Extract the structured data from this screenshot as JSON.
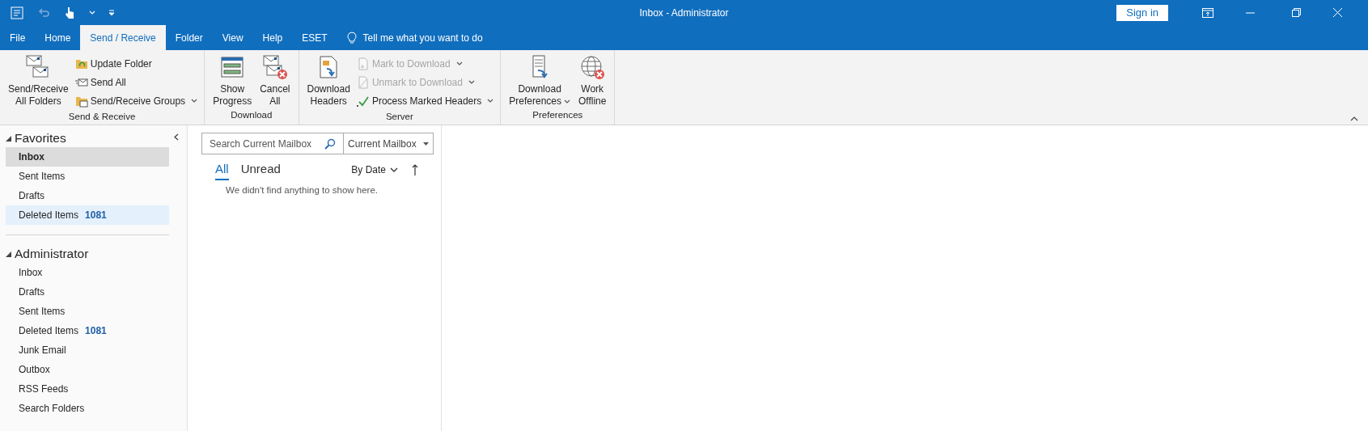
{
  "window": {
    "title": "Inbox - Administrator",
    "sign_in": "Sign in"
  },
  "tabs": [
    {
      "label": "File",
      "selected": false
    },
    {
      "label": "Home",
      "selected": false
    },
    {
      "label": "Send / Receive",
      "selected": true
    },
    {
      "label": "Folder",
      "selected": false
    },
    {
      "label": "View",
      "selected": false
    },
    {
      "label": "Help",
      "selected": false
    },
    {
      "label": "ESET",
      "selected": false
    }
  ],
  "tell_me": "Tell me what you want to do",
  "ribbon": {
    "groups": [
      {
        "label": "Send & Receive",
        "items": [
          {
            "kind": "large",
            "lines": [
              "Send/Receive",
              "All Folders"
            ],
            "disabled": false,
            "dropdown": false
          },
          {
            "kind": "small",
            "lines": [
              "Update Folder"
            ],
            "disabled": false,
            "dropdown": false
          },
          {
            "kind": "small",
            "lines": [
              "Send All"
            ],
            "disabled": false,
            "dropdown": false
          },
          {
            "kind": "small",
            "lines": [
              "Send/Receive Groups"
            ],
            "disabled": false,
            "dropdown": true
          }
        ]
      },
      {
        "label": "Download",
        "items": [
          {
            "kind": "large",
            "lines": [
              "Show",
              "Progress"
            ],
            "disabled": false,
            "dropdown": false
          },
          {
            "kind": "large",
            "lines": [
              "Cancel",
              "All"
            ],
            "disabled": false,
            "dropdown": false
          }
        ]
      },
      {
        "label": "Server",
        "items": [
          {
            "kind": "large",
            "lines": [
              "Download",
              "Headers"
            ],
            "disabled": false,
            "dropdown": false
          },
          {
            "kind": "small",
            "lines": [
              "Mark to Download"
            ],
            "disabled": true,
            "dropdown": true
          },
          {
            "kind": "small",
            "lines": [
              "Unmark to Download"
            ],
            "disabled": true,
            "dropdown": true
          },
          {
            "kind": "small",
            "lines": [
              "Process Marked Headers"
            ],
            "disabled": false,
            "dropdown": true
          }
        ]
      },
      {
        "label": "Preferences",
        "items": [
          {
            "kind": "large",
            "lines": [
              "Download",
              "Preferences"
            ],
            "disabled": false,
            "dropdown": true
          },
          {
            "kind": "large",
            "lines": [
              "Work",
              "Offline"
            ],
            "disabled": false,
            "dropdown": false
          }
        ]
      }
    ]
  },
  "folder_pane": {
    "sections": [
      {
        "title": "Favorites",
        "expanded": true,
        "items": [
          {
            "label": "Inbox",
            "selected": true,
            "hovered": false
          },
          {
            "label": "Sent Items",
            "selected": false,
            "hovered": false
          },
          {
            "label": "Drafts",
            "selected": false,
            "hovered": false
          },
          {
            "label": "Deleted Items",
            "count": "1081",
            "selected": false,
            "hovered": true
          }
        ]
      },
      {
        "title": "Administrator",
        "expanded": true,
        "items": [
          {
            "label": "Inbox",
            "selected": false,
            "hovered": false
          },
          {
            "label": "Drafts",
            "selected": false,
            "hovered": false
          },
          {
            "label": "Sent Items",
            "selected": false,
            "hovered": false
          },
          {
            "label": "Deleted Items",
            "count": "1081",
            "selected": false,
            "hovered": false
          },
          {
            "label": "Junk Email",
            "selected": false,
            "hovered": false
          },
          {
            "label": "Outbox",
            "selected": false,
            "hovered": false
          },
          {
            "label": "RSS Feeds",
            "selected": false,
            "hovered": false
          },
          {
            "label": "Search Folders",
            "selected": false,
            "hovered": false
          }
        ]
      }
    ]
  },
  "message_list": {
    "search": {
      "placeholder": "Search Current Mailbox"
    },
    "scope": "Current Mailbox",
    "filters": [
      {
        "label": "All",
        "selected": true
      },
      {
        "label": "Unread",
        "selected": false
      }
    ],
    "sort": "By Date",
    "empty_message": "We didn't find anything to show here."
  }
}
